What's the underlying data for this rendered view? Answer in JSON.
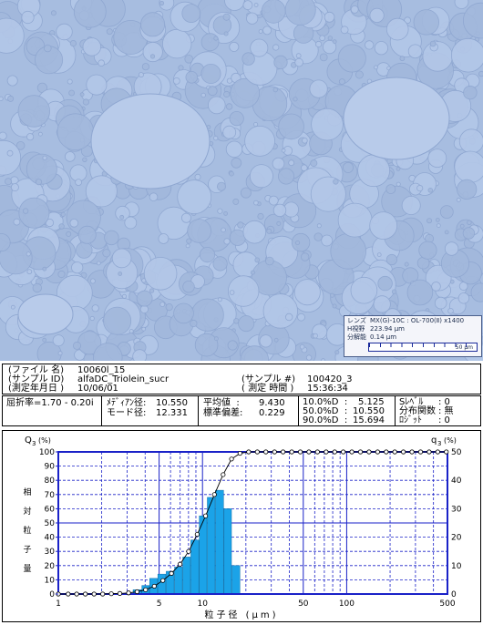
{
  "micrograph": {
    "scale_info": {
      "lens_label": "レンズ",
      "lens_value": "MX(G)-10C : OL-700(Ⅱ) x1400",
      "fov_label": "H視野",
      "fov_value": "223.94 μm",
      "res_label": "分解能",
      "res_value": "0.14 μm",
      "scale_bar_label": "50 μm"
    }
  },
  "info": {
    "file_label": "(ファイル 名)",
    "file_value": "10060l_15",
    "sample_id_label": "(サンプル ID)",
    "sample_id_value": "alfaDC_Triolein_sucr",
    "date_label": "(測定年月日 )",
    "date_value": "10/06/01",
    "sample_no_label": "(サンプル #)",
    "sample_no_value": "100420_3",
    "time_label": "( 測定 時間 )",
    "time_value": "15:36:34"
  },
  "stats": {
    "refractive_index": "屈折率=1.70 - 0.20i",
    "median_label": "ﾒﾃﾞｨｱﾝ径:",
    "median_value": "10.550",
    "mode_label": "モード径:",
    "mode_value": "12.331",
    "mean_label": "平均値  :",
    "mean_value": "9.430",
    "std_label": "標準偏差:",
    "std_value": "0.229",
    "d10_label": "10.0%D  :",
    "d10_value": "5.125",
    "d50_label": "50.0%D  :",
    "d50_value": "10.550",
    "d90_label": "90.0%D  :",
    "d90_value": "15.694",
    "slevel_label": "Sﾚﾍﾞﾙ",
    "slevel_value": ": 0",
    "dist_label": "分布関数",
    "dist_value": ": 無",
    "lot_label": "ﾛｼﾞｯﾄ",
    "lot_value": ": 0"
  },
  "colors": {
    "bar_fill": "#1ba3e8",
    "axis": "#1a22c8",
    "curve": "#000000"
  },
  "chart_data": {
    "type": "bar",
    "xlabel": "粒子径 (μm)",
    "ylabel_left": "相対粒子量",
    "left_axis_title_main": "Q",
    "left_axis_title_sub": "3",
    "left_axis_title_unit": "(%)",
    "right_axis_title_main": "q",
    "right_axis_title_sub": "3",
    "right_axis_title_unit": "(%)",
    "x_scale": "log",
    "xlim": [
      1,
      500
    ],
    "x_ticks": [
      1,
      5,
      10,
      50,
      100,
      500
    ],
    "y_left_lim": [
      0,
      100
    ],
    "y_left_ticks": [
      0,
      10,
      20,
      30,
      40,
      50,
      60,
      70,
      80,
      90,
      100
    ],
    "y_right_lim": [
      0,
      50
    ],
    "y_right_ticks": [
      0,
      10,
      20,
      30,
      40,
      50
    ],
    "grid": true,
    "bars_q3": {
      "edges": [
        3.3,
        3.8,
        4.3,
        4.9,
        5.6,
        6.4,
        7.3,
        8.3,
        9.5,
        10.8,
        12.3,
        14.1,
        16.0,
        18.3
      ],
      "values": [
        1.5,
        3.0,
        5.5,
        7.0,
        8.0,
        9.5,
        13.0,
        19.0,
        27.5,
        34.0,
        36.5,
        30.0,
        10.0,
        2.0
      ]
    },
    "curve_Q3": {
      "x": [
        1.0,
        1.17,
        1.34,
        1.54,
        1.77,
        2.03,
        2.33,
        2.67,
        3.07,
        3.52,
        4.03,
        4.63,
        5.31,
        6.09,
        6.99,
        8.01,
        9.19,
        10.5,
        12.1,
        13.9,
        15.9,
        18.2,
        20.9,
        24.0,
        27.5,
        31.6,
        36.2,
        41.6,
        47.7,
        54.7,
        62.7,
        72.0,
        82.6,
        94.7,
        108.6,
        124.6,
        142.9,
        163.9,
        188.0,
        215.6,
        247.3,
        283.7,
        325.4,
        373.2,
        428.1,
        491.0
      ],
      "y": [
        0,
        0,
        0,
        0,
        0,
        0,
        0.2,
        0.4,
        0.8,
        1.6,
        3.0,
        5.5,
        9.5,
        14.5,
        21.0,
        30.0,
        42.0,
        55.0,
        70.0,
        84.0,
        95.0,
        99.0,
        100,
        100,
        100,
        100,
        100,
        100,
        100,
        100,
        100,
        100,
        100,
        100,
        100,
        100,
        100,
        100,
        100,
        100,
        100,
        100,
        100,
        100,
        100,
        100
      ]
    }
  }
}
